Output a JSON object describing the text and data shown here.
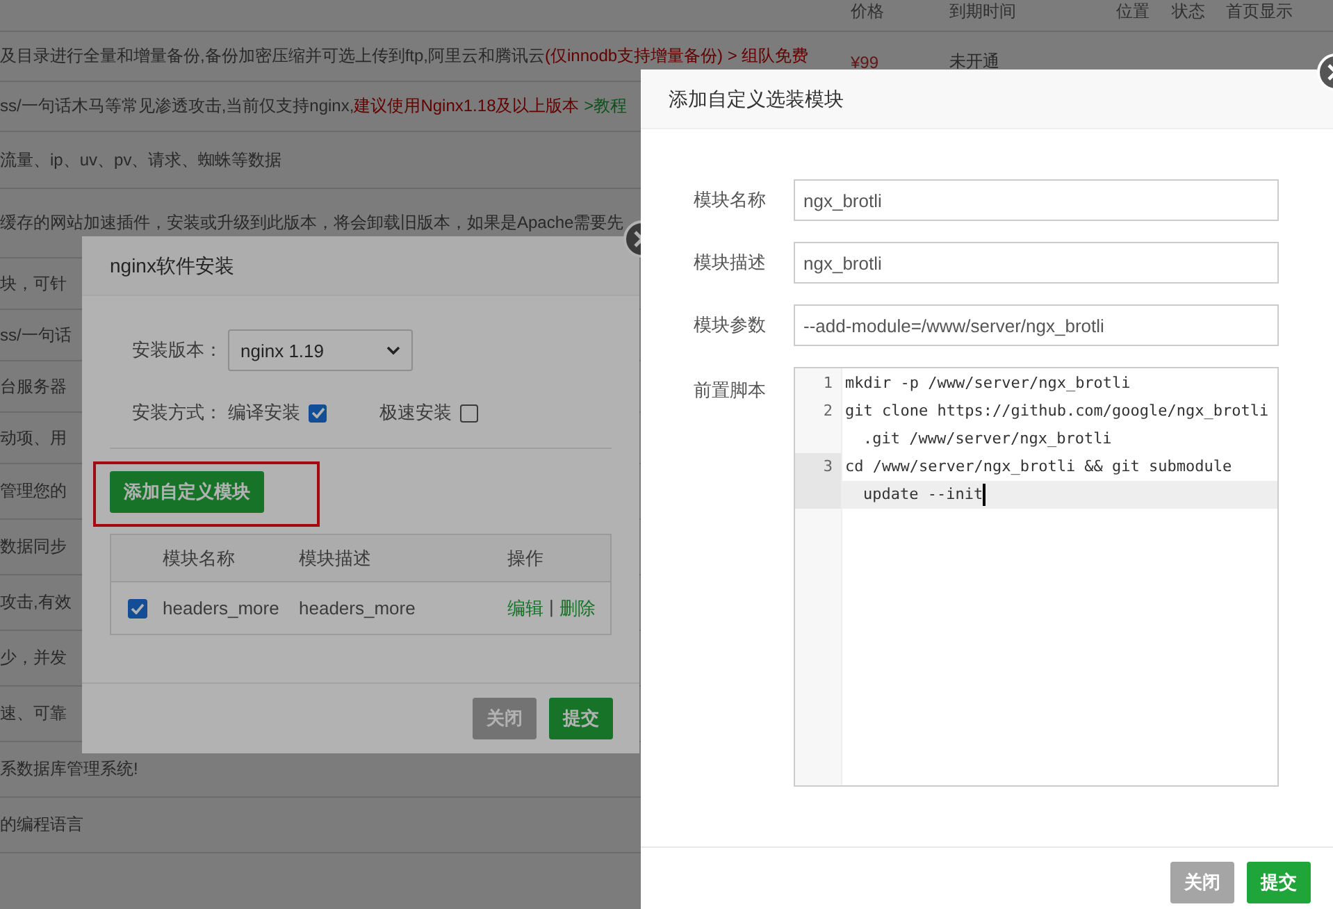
{
  "page": {
    "columns": [
      "价格",
      "到期时间",
      "位置",
      "状态",
      "首页显示"
    ],
    "rows": [
      {
        "description": [
          {
            "kind": "plain",
            "text": "及目录进行全量和增量备份,备份加密压缩并可选上传到ftp,阿里云和腾讯云"
          },
          {
            "kind": "warning",
            "text": "(仅innodb支持增量备份) > 组队免费"
          }
        ],
        "price": "¥99",
        "expiry": "未开通"
      },
      {
        "description": [
          {
            "kind": "plain",
            "text": "ss/一句话木马等常见渗透攻击,当前仅支持nginx,"
          },
          {
            "kind": "warning",
            "text": "建议使用Nginx1.18及以上版本"
          },
          {
            "kind": "link",
            "text": " >教程"
          }
        ]
      },
      {
        "description": [
          {
            "kind": "plain",
            "text": "流量、ip、uv、pv、请求、蜘蛛等数据"
          }
        ]
      },
      {
        "description": [
          {
            "kind": "plain",
            "text": "缓存的网站加速插件，安装或升级到此版本，将会卸载旧版本，如果是Apache需要先"
          }
        ]
      },
      {
        "description": [
          {
            "kind": "plain",
            "text": "块，可针"
          }
        ]
      },
      {
        "description": [
          {
            "kind": "plain",
            "text": "ss/一句话"
          }
        ]
      },
      {
        "description": [
          {
            "kind": "plain",
            "text": "台服务器"
          }
        ]
      },
      {
        "description": [
          {
            "kind": "plain",
            "text": "动项、用"
          }
        ]
      },
      {
        "description": [
          {
            "kind": "plain",
            "text": "管理您的"
          }
        ]
      },
      {
        "description": [
          {
            "kind": "plain",
            "text": "数据同步"
          }
        ]
      },
      {
        "description": [
          {
            "kind": "plain",
            "text": "攻击,有效"
          }
        ]
      },
      {
        "description": [
          {
            "kind": "plain",
            "text": "少，并发"
          }
        ]
      },
      {
        "description": [
          {
            "kind": "plain",
            "text": "速、可靠"
          }
        ]
      },
      {
        "description": [
          {
            "kind": "plain",
            "text": "系数据库管理系统!"
          }
        ]
      },
      {
        "description": [
          {
            "kind": "plain",
            "text": "的编程语言"
          }
        ]
      }
    ]
  },
  "install_dialog": {
    "title": "nginx软件安装",
    "version_label": "安装版本：",
    "version": "nginx 1.19",
    "method_label": "安装方式：",
    "methods": [
      {
        "label": "编译安装",
        "checked": true
      },
      {
        "label": "极速安装",
        "checked": false
      }
    ],
    "add_button": {
      "label": "添加自定义模块",
      "highlighted": true
    },
    "table": {
      "columns": [
        "模块名称",
        "模块描述",
        "操作"
      ],
      "rows": [
        {
          "checked": true,
          "name": "headers_more",
          "description": "headers_more",
          "actions": [
            "编辑",
            "删除"
          ],
          "separator": "|"
        }
      ]
    },
    "buttons": [
      {
        "label": "关闭",
        "kind": "secondary"
      },
      {
        "label": "提交",
        "kind": "primary"
      }
    ]
  },
  "module_dialog": {
    "title": "添加自定义选装模块",
    "fields": [
      {
        "label": "模块名称",
        "value": "ngx_brotli"
      },
      {
        "label": "模块描述",
        "value": "ngx_brotli"
      },
      {
        "label": "模块参数",
        "value": "--add-module=/www/server/ngx_brotli"
      }
    ],
    "script_label": "前置脚本",
    "script_lines": [
      {
        "number": "1",
        "rows": [
          "mkdir -p /www/server/ngx_brotli"
        ],
        "active": false
      },
      {
        "number": "2",
        "rows": [
          "git clone https://github.com/google/ngx_brotli",
          ".git /www/server/ngx_brotli"
        ],
        "active": false
      },
      {
        "number": "3",
        "rows": [
          "cd /www/server/ngx_brotli && git submodule",
          "update --init"
        ],
        "active": true
      }
    ],
    "buttons": [
      {
        "label": "关闭",
        "kind": "secondary"
      },
      {
        "label": "提交",
        "kind": "primary"
      }
    ]
  }
}
